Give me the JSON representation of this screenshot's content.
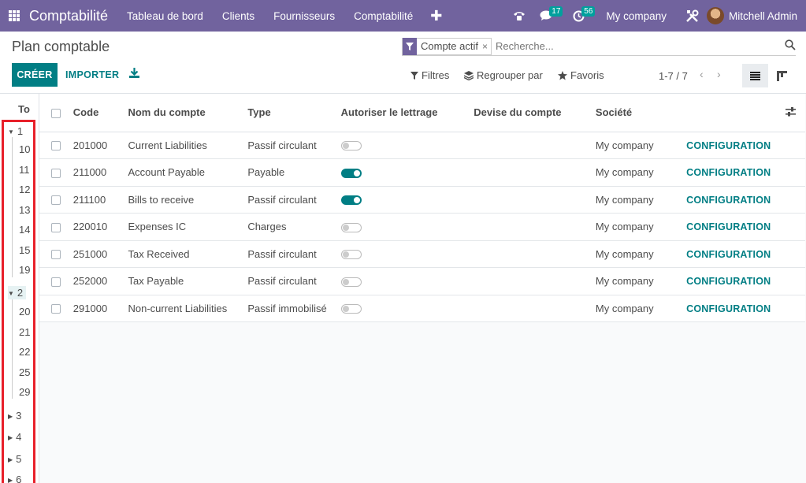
{
  "navbar": {
    "brand": "Comptabilité",
    "menu": [
      "Tableau de bord",
      "Clients",
      "Fournisseurs",
      "Comptabilité"
    ],
    "plus": "✚",
    "chat_count": "17",
    "activity_count": "56",
    "company": "My company",
    "user": "Mitchell Admin"
  },
  "page": {
    "title": "Plan comptable",
    "create_label": "CRÉER",
    "import_label": "IMPORTER"
  },
  "search": {
    "facet_label": "Compte actif",
    "facet_remove": "×",
    "placeholder": "Recherche..."
  },
  "filters": {
    "filters_label": "Filtres",
    "group_label": "Regrouper par",
    "favorites_label": "Favoris"
  },
  "pager": {
    "text": "1-7 / 7",
    "prev": "‹",
    "next": "›"
  },
  "side_panel": {
    "header": "To",
    "items": [
      {
        "label": "1",
        "level": 0,
        "expanded": true,
        "active": false
      },
      {
        "label": "10",
        "level": 1
      },
      {
        "label": "11",
        "level": 1
      },
      {
        "label": "12",
        "level": 1
      },
      {
        "label": "13",
        "level": 1
      },
      {
        "label": "14",
        "level": 1
      },
      {
        "label": "15",
        "level": 1
      },
      {
        "label": "19",
        "level": 1
      },
      {
        "label": "2",
        "level": 0,
        "expanded": true,
        "active": true
      },
      {
        "label": "20",
        "level": 1
      },
      {
        "label": "21",
        "level": 1
      },
      {
        "label": "22",
        "level": 1
      },
      {
        "label": "25",
        "level": 1
      },
      {
        "label": "29",
        "level": 1
      },
      {
        "label": "3",
        "level": 0,
        "expanded": false
      },
      {
        "label": "4",
        "level": 0,
        "expanded": false
      },
      {
        "label": "5",
        "level": 0,
        "expanded": false
      },
      {
        "label": "6",
        "level": 0,
        "expanded": false
      }
    ]
  },
  "table": {
    "columns": [
      "Code",
      "Nom du compte",
      "Type",
      "Autoriser le lettrage",
      "Devise du compte",
      "Société"
    ],
    "rows": [
      {
        "code": "201000",
        "name": "Current Liabilities",
        "type": "Passif circulant",
        "reconcile": false,
        "currency": "",
        "company": "My company",
        "action": "CONFIGURATION"
      },
      {
        "code": "211000",
        "name": "Account Payable",
        "type": "Payable",
        "reconcile": true,
        "currency": "",
        "company": "My company",
        "action": "CONFIGURATION"
      },
      {
        "code": "211100",
        "name": "Bills to receive",
        "type": "Passif circulant",
        "reconcile": true,
        "currency": "",
        "company": "My company",
        "action": "CONFIGURATION"
      },
      {
        "code": "220010",
        "name": "Expenses IC",
        "type": "Charges",
        "reconcile": false,
        "currency": "",
        "company": "My company",
        "action": "CONFIGURATION"
      },
      {
        "code": "251000",
        "name": "Tax Received",
        "type": "Passif circulant",
        "reconcile": false,
        "currency": "",
        "company": "My company",
        "action": "CONFIGURATION"
      },
      {
        "code": "252000",
        "name": "Tax Payable",
        "type": "Passif circulant",
        "reconcile": false,
        "currency": "",
        "company": "My company",
        "action": "CONFIGURATION"
      },
      {
        "code": "291000",
        "name": "Non-current Liabilities",
        "type": "Passif immobilisé",
        "reconcile": false,
        "currency": "",
        "company": "My company",
        "action": "CONFIGURATION"
      }
    ]
  },
  "colors": {
    "navbar": "#71639e",
    "primary": "#017e84",
    "highlight_frame": "#e8202a"
  }
}
